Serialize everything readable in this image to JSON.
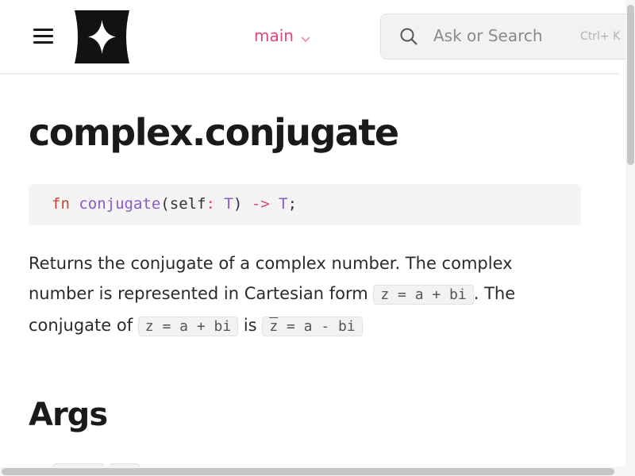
{
  "header": {
    "branch_label": "main",
    "search_placeholder": "Ask or Search",
    "search_shortcut": "Ctrl+ K"
  },
  "page": {
    "title": "complex.conjugate",
    "signature": {
      "keyword": "fn",
      "name": "conjugate",
      "open": "(",
      "param": "self",
      "colon": ":",
      "param_type": "T",
      "close": ")",
      "arrow": "->",
      "return_type": "T",
      "semicolon": ";"
    },
    "description": {
      "part1": "Returns the conjugate of a complex number. The complex number is represented in Cartesian form ",
      "code1": "z = a + bi",
      "part2": ". The conjugate of ",
      "code2": "z = a + bi",
      "part3": " is ",
      "code3_z": "z",
      "code3_rest": " = a - bi"
    },
    "section_heading": "Args"
  },
  "colors": {
    "accent": "#e0457b",
    "keyword": "#c4442d",
    "function": "#8a5ac8"
  },
  "icons": {
    "menu": "hamburger-menu-icon",
    "logo": "four-point-star-logo",
    "branch_chevron": "chevron-down-icon",
    "search": "search-icon"
  }
}
